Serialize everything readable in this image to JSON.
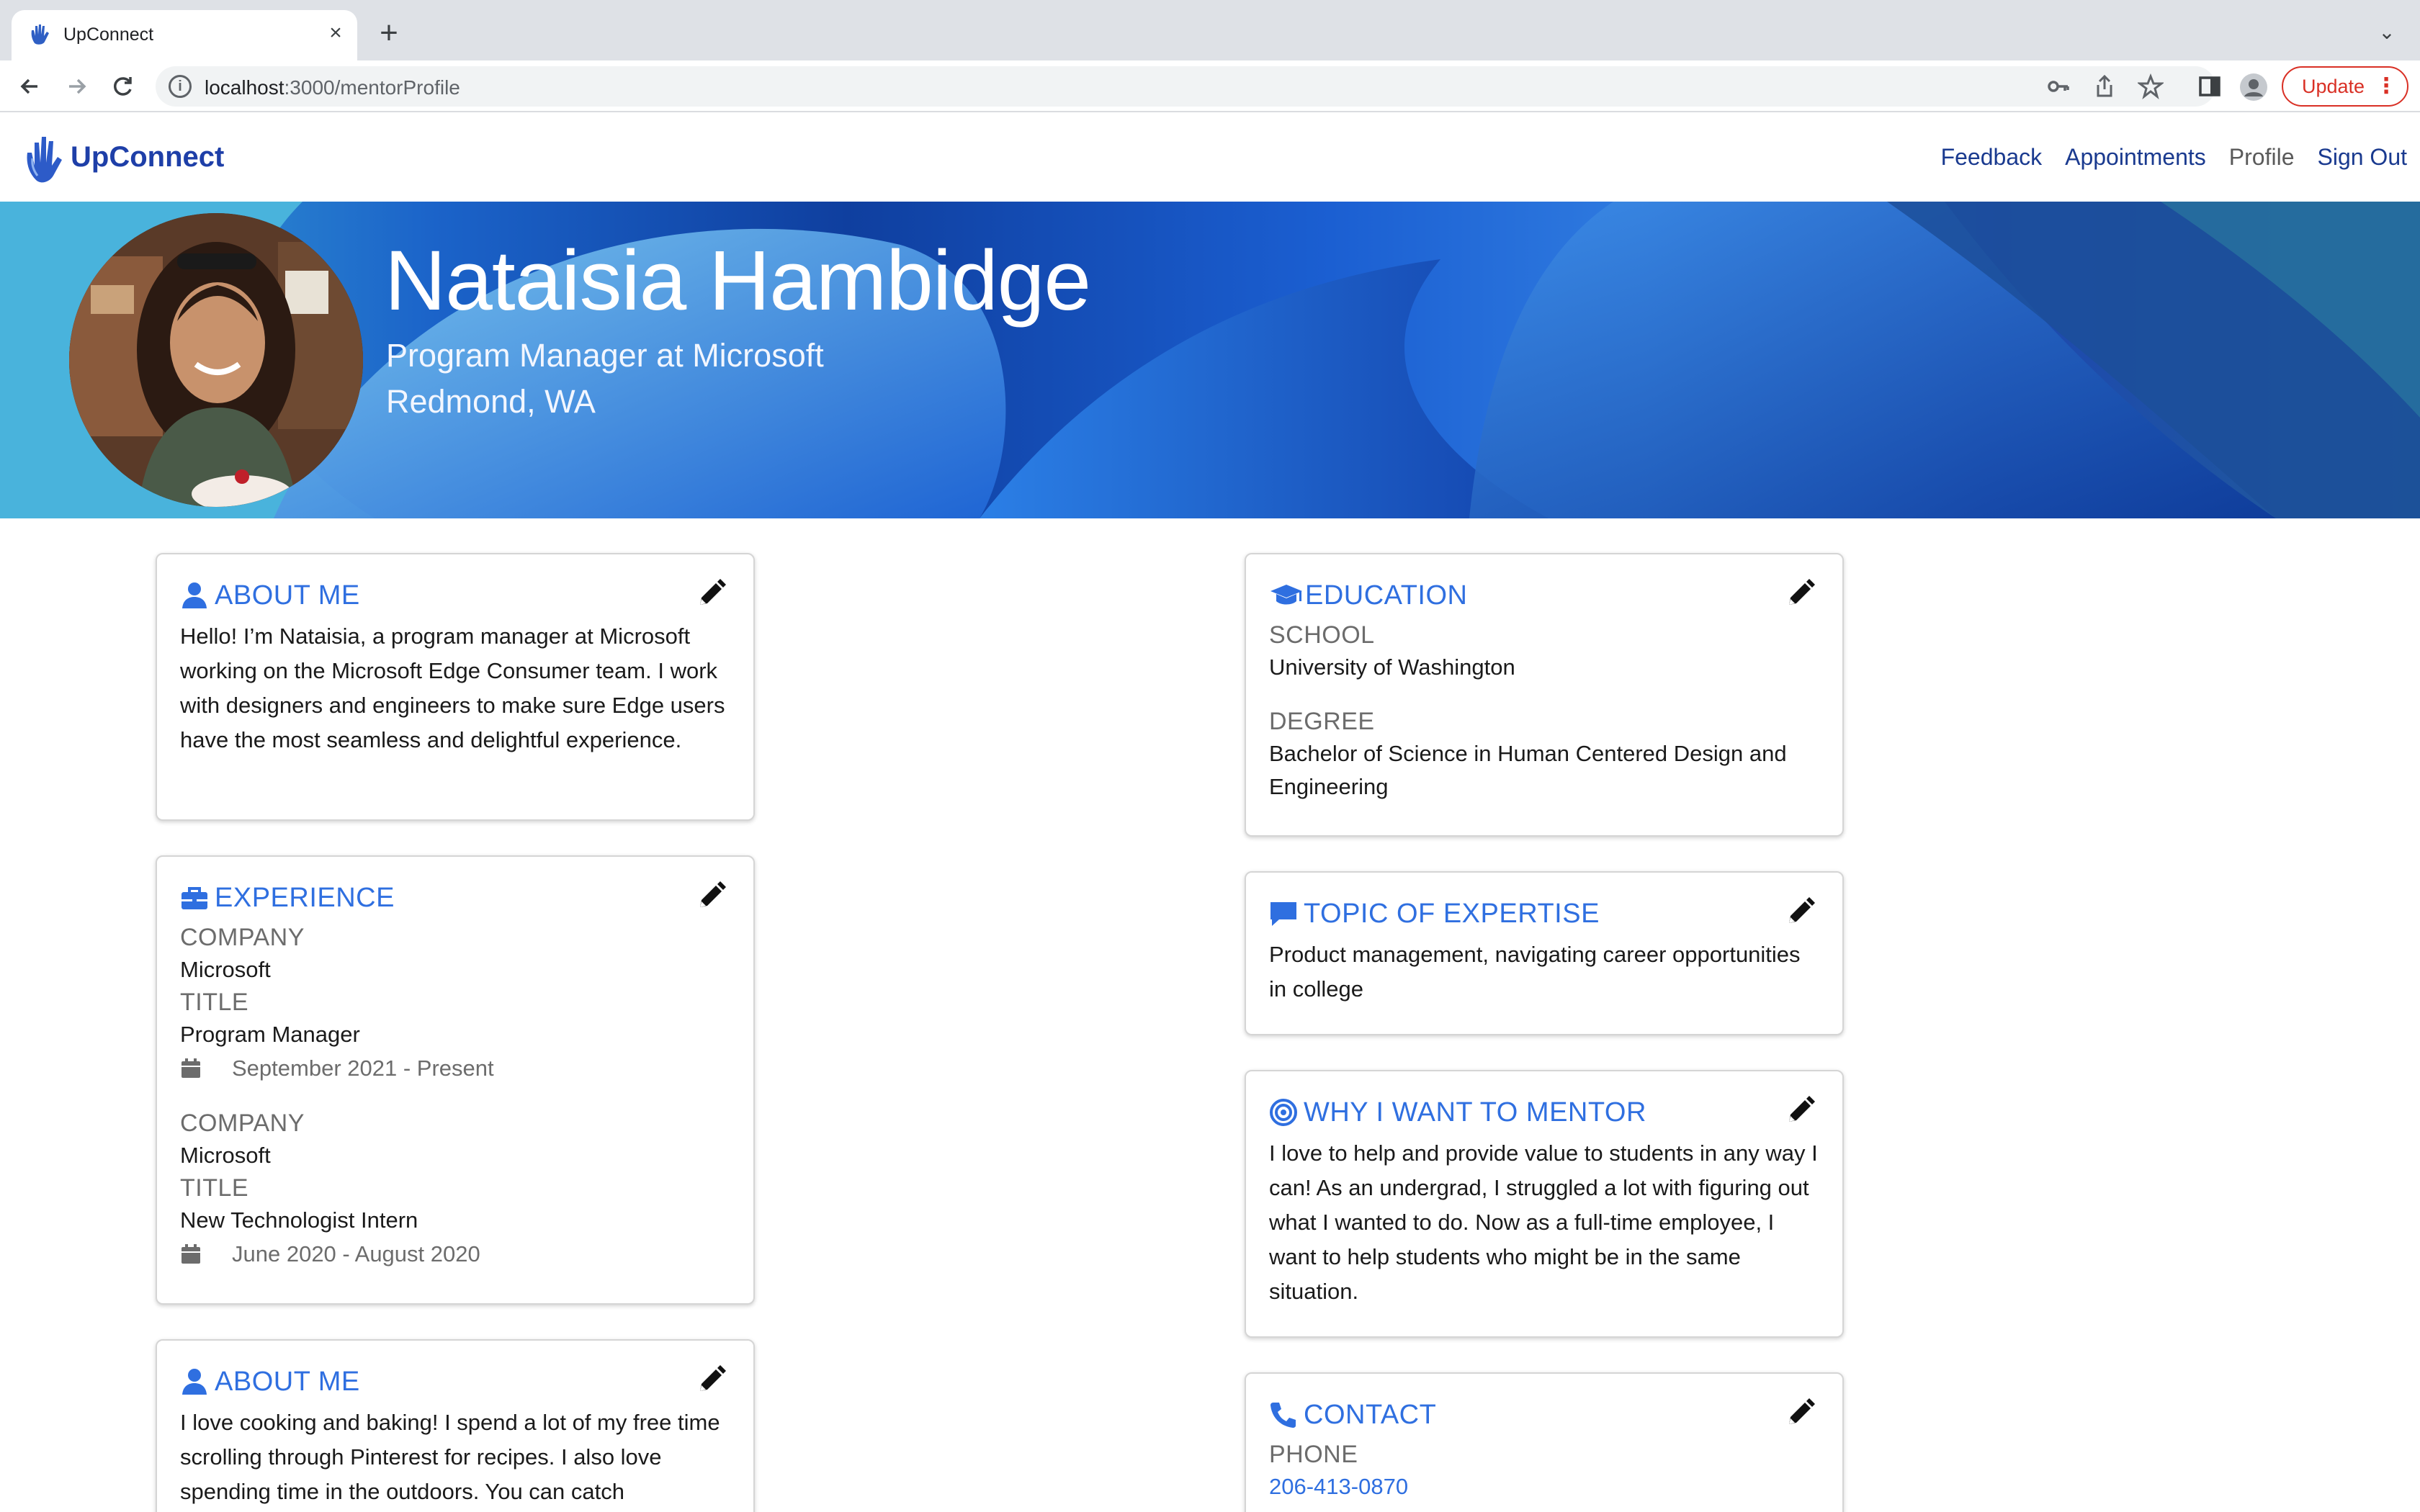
{
  "browser": {
    "tab_title": "UpConnect",
    "new_tab_symbol": "+",
    "close_symbol": "×",
    "dropdown_symbol": "⌄",
    "url_host": "localhost",
    "url_path": ":3000/mentorProfile",
    "update_label": "Update",
    "update_color": "#d93025"
  },
  "navbar": {
    "brand": "UpConnect",
    "brand_color": "#1e3fa8",
    "links": [
      "Feedback",
      "Appointments",
      "Profile",
      "Sign Out"
    ]
  },
  "hero": {
    "name": "Nataisia Hambidge",
    "title": "Program Manager at Microsoft",
    "location": "Redmond, WA"
  },
  "cards": {
    "about": {
      "title": "ABOUT ME",
      "text": "Hello! I’m Nataisia, a program manager at Microsoft working on the Microsoft Edge Consumer team. I work with designers and engineers to make sure Edge users have the most seamless and delightful experience."
    },
    "experience": {
      "title": "EXPERIENCE",
      "items": [
        {
          "company_label": "COMPANY",
          "company": "Microsoft",
          "title_label": "TITLE",
          "title": "Program Manager",
          "dates": "September 2021 - Present"
        },
        {
          "company_label": "COMPANY",
          "company": "Microsoft",
          "title_label": "TITLE",
          "title": "New Technologist Intern",
          "dates": "June 2020 - August 2020"
        }
      ]
    },
    "about2": {
      "title": "ABOUT ME",
      "text": "I love cooking and baking! I spend a lot of my free time scrolling through Pinterest for recipes. I also love spending time in the outdoors. You can catch"
    },
    "education": {
      "title": "EDUCATION",
      "school_label": "SCHOOL",
      "school": "University of Washington",
      "degree_label": "DEGREE",
      "degree": "Bachelor of Science in Human Centered Design and Engineering"
    },
    "expertise": {
      "title": "TOPIC OF EXPERTISE",
      "text": "Product management, navigating career opportunities in college"
    },
    "why": {
      "title": "WHY I WANT TO MENTOR",
      "text": "I love to help and provide value to students in any way I can! As an undergrad, I struggled a lot with figuring out what I wanted to do. Now as a full-time employee, I want to help students who might be in the same situation."
    },
    "contact": {
      "title": "CONTACT",
      "phone_label": "PHONE",
      "phone": "206-413-0870"
    }
  },
  "colors": {
    "accent": "#2f6fe0",
    "label_gray": "#6c6c6c"
  }
}
